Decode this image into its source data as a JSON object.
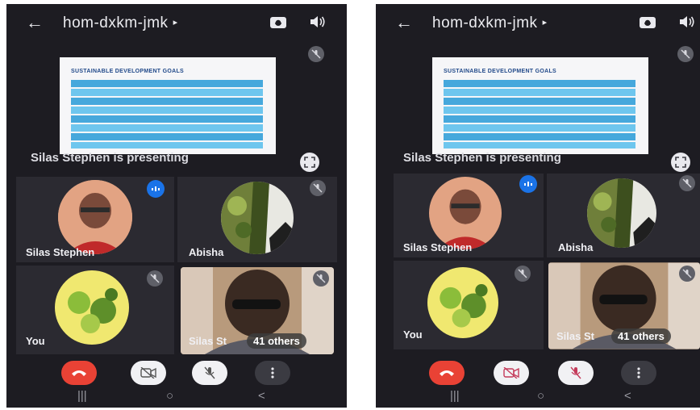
{
  "meeting": {
    "code": "hom-dxkm-jmk",
    "chevron": "▸",
    "presenting_text": "Silas Stephen is presenting"
  },
  "slide": {
    "title": "SUSTAINABLE DEVELOPMENT GOALS"
  },
  "participants": {
    "tile1_name": "Silas Stephen",
    "tile2_name": "Abisha",
    "tile3_name": "You",
    "tile4_name": "Silas St",
    "others_label": "41 others"
  },
  "nav": {
    "recents": "|||",
    "home": "○",
    "back": "<"
  },
  "colors": {
    "end_call": "#e94235",
    "speaking_badge": "#1a73e8",
    "background": "#1d1c22"
  }
}
